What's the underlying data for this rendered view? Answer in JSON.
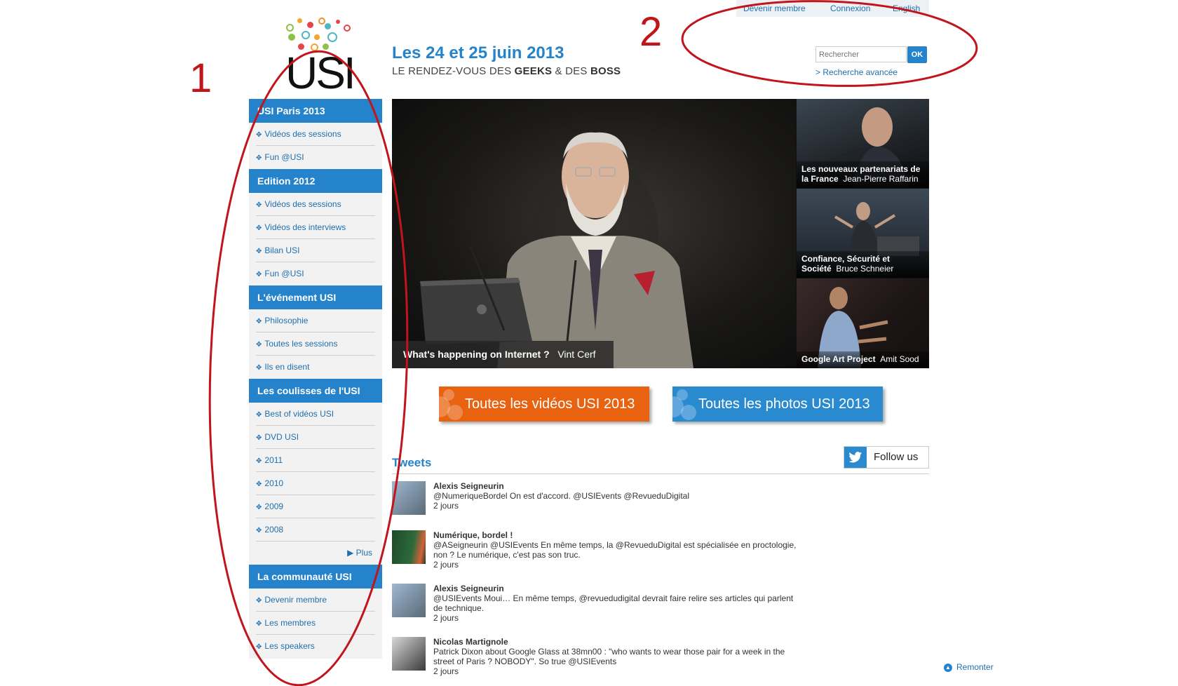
{
  "logo": {
    "text": "USI"
  },
  "header": {
    "date": "Les 24 et 25 juin 2013",
    "tagline_prefix": "LE RENDEZ-VOUS DES ",
    "tagline_geeks": "GEEKS",
    "tagline_and": " & DES ",
    "tagline_boss": "BOSS"
  },
  "toplinks": {
    "devenir": "Devenir membre",
    "connexion": "Connexion",
    "english": "English"
  },
  "search": {
    "placeholder": "Rechercher",
    "ok": "OK",
    "advanced": "> Recherche avancée"
  },
  "sidebar": {
    "sections": [
      {
        "title": "USI Paris 2013",
        "links": [
          "Vidéos des sessions",
          "Fun @USI"
        ]
      },
      {
        "title": "Edition 2012",
        "links": [
          "Vidéos des sessions",
          "Vidéos des interviews",
          "Bilan USI",
          "Fun @USI"
        ]
      },
      {
        "title": "L'événement USI",
        "links": [
          "Philosophie",
          "Toutes les sessions",
          "Ils en disent"
        ]
      },
      {
        "title": "Les coulisses de l'USI",
        "links": [
          "Best of vidéos USI",
          "DVD USI",
          "2011",
          "2010",
          "2009",
          "2008"
        ],
        "more": "Plus"
      },
      {
        "title": "La communauté USI",
        "links": [
          "Devenir membre",
          "Les membres",
          "Les speakers"
        ]
      }
    ]
  },
  "hero": {
    "main_title": "What's happening on Internet ?",
    "main_speaker": "Vint Cerf",
    "thumbs": [
      {
        "title": "Les nouveaux partenariats de la France",
        "speaker": "Jean-Pierre Raffarin"
      },
      {
        "title": "Confiance, Sécurité et Société",
        "speaker": "Bruce Schneier"
      },
      {
        "title": "Google Art Project",
        "speaker": "Amit Sood"
      }
    ]
  },
  "cta": {
    "videos": "Toutes les vidéos USI 2013",
    "photos": "Toutes les photos USI 2013",
    "videos_color": "#e8620f",
    "photos_color": "#2a8ad0"
  },
  "tweets": {
    "title": "Tweets",
    "follow": "Follow us",
    "items": [
      {
        "author": "Alexis Seigneurin",
        "text": "@NumeriqueBordel On est d'accord. @USIEvents @RevueduDigital",
        "time": "2 jours"
      },
      {
        "author": "Numérique, bordel !",
        "text": "@ASeigneurin @USIEvents En même temps, la @RevueduDigital est spécialisée en proctologie, non ? Le numérique, c'est pas son truc.",
        "time": "2 jours"
      },
      {
        "author": "Alexis Seigneurin",
        "text": "@USIEvents Moui… En même temps, @revuedudigital devrait faire relire ses articles qui parlent de technique.",
        "time": "2 jours"
      },
      {
        "author": "Nicolas Martignole",
        "text": "Patrick Dixon about Google Glass at 38mn00 : \"who wants to wear those pair for a week in the street of Paris ? NOBODY\". So true @USIEvents",
        "time": "2 jours"
      }
    ]
  },
  "footer": {
    "remonter": "Remonter"
  },
  "annotations": {
    "one": "1",
    "two": "2",
    "color": "#c1141b"
  },
  "colors": {
    "brand_blue": "#2583cb",
    "link_blue": "#1f6fae"
  }
}
